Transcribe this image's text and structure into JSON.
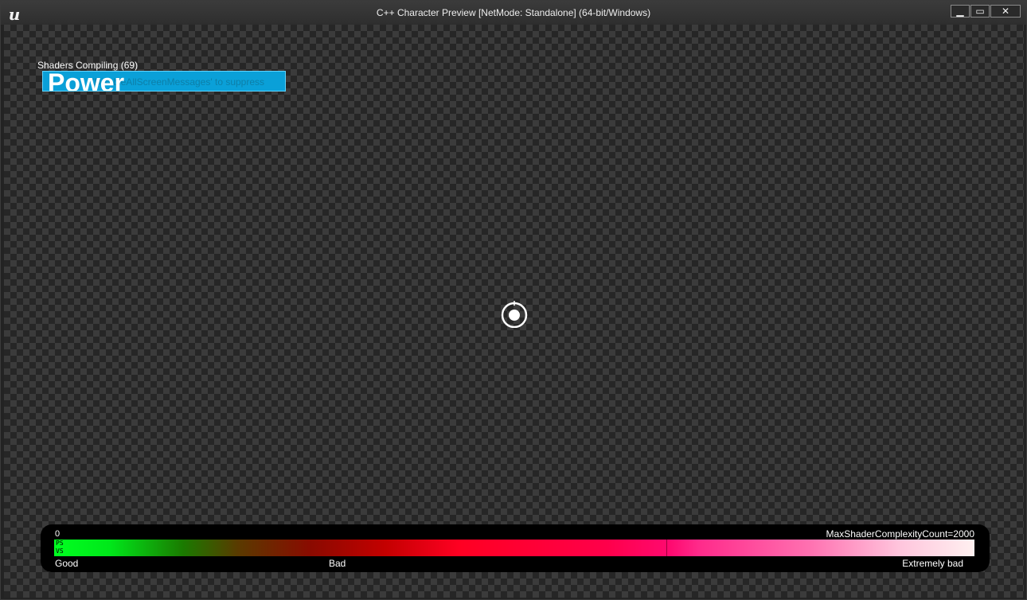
{
  "window": {
    "title": "C++ Character Preview [NetMode: Standalone] (64-bit/Windows)",
    "logo_glyph": "u",
    "logo_icon": "unreal-logo-icon",
    "controls": {
      "minimize_glyph": "▁",
      "maximize_glyph": "▭",
      "close_glyph": "✕"
    }
  },
  "hud": {
    "shader_message": "Shaders Compiling (69)",
    "power_hint": "'DisableAllScreenMessages' to suppress",
    "power_label": "Power",
    "crosshair_icon": "crosshair-icon"
  },
  "shader_complexity": {
    "min_label": "0",
    "max_label": "MaxShaderComplexityCount=2000",
    "ps_label": "PS",
    "vs_label": "VS",
    "good_label": "Good",
    "bad_label": "Bad",
    "extremely_bad_label": "Extremely bad",
    "gradient_colors": [
      "#00ff20",
      "#1a7a00",
      "#8b0a00",
      "#ff0022",
      "#ff004a",
      "#ff70b0",
      "#fff0f0"
    ]
  }
}
